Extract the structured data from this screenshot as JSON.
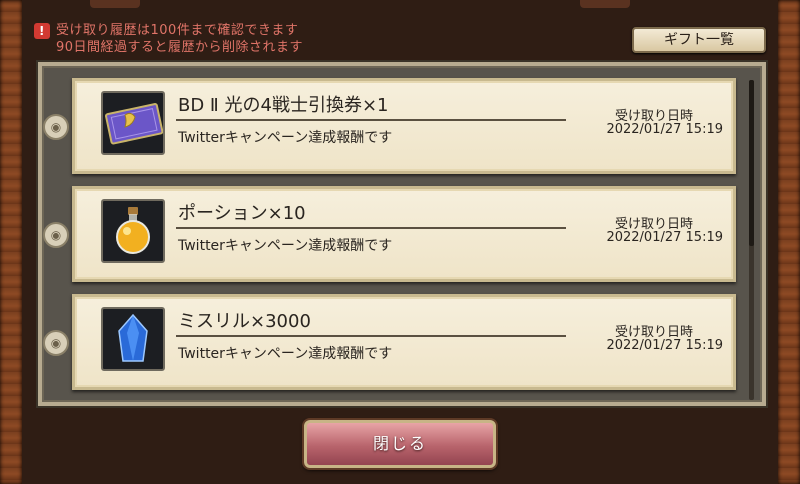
{
  "notice": {
    "line1": "受け取り履歴は100件まで確認できます",
    "line2": "90日間経過すると履歴から削除されます",
    "icon": "!"
  },
  "header": {
    "gift_list_label": "ギフト一覧"
  },
  "items": [
    {
      "name": "BD Ⅱ 光の4戦士引換券×1",
      "description": "Twitterキャンペーン達成報酬です",
      "date_label": "受け取り日時",
      "date_value": "2022/01/27 15:19",
      "icon": "ticket-icon"
    },
    {
      "name": "ポーション×10",
      "description": "Twitterキャンペーン達成報酬です",
      "date_label": "受け取り日時",
      "date_value": "2022/01/27 15:19",
      "icon": "potion-icon"
    },
    {
      "name": "ミスリル×3000",
      "description": "Twitterキャンペーン達成報酬です",
      "date_label": "受け取り日時",
      "date_value": "2022/01/27 15:19",
      "icon": "crystal-icon"
    }
  ],
  "footer": {
    "close_label": "閉じる"
  },
  "colors": {
    "notice_text": "#e07468",
    "close_button": "#b8646c",
    "item_background": "#f6efdc"
  }
}
